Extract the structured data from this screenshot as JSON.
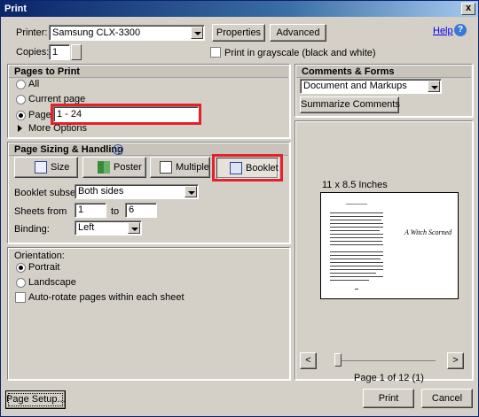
{
  "window": {
    "title": "Print",
    "close": "x"
  },
  "printer": {
    "label": "Printer:",
    "value": "Samsung CLX-3300",
    "properties": "Properties",
    "advanced": "Advanced",
    "help": "Help",
    "copies_label": "Copies:",
    "copies_value": "1",
    "grayscale_label": "Print in grayscale (black and white)"
  },
  "pages": {
    "heading": "Pages to Print",
    "all": "All",
    "current": "Current page",
    "pages": "Pages",
    "range": "1 - 24",
    "more": "More Options"
  },
  "sizing": {
    "heading": "Page Sizing & Handling",
    "info_icon": "i",
    "buttons": {
      "size": "Size",
      "poster": "Poster",
      "multiple": "Multiple",
      "booklet": "Booklet"
    },
    "subset_label": "Booklet subset:",
    "subset_value": "Both sides",
    "sheets_label": "Sheets from",
    "sheets_from": "1",
    "to_label": "to",
    "sheets_to": "6",
    "binding_label": "Binding:",
    "binding_value": "Left"
  },
  "orientation": {
    "label": "Orientation:",
    "portrait": "Portrait",
    "landscape": "Landscape",
    "autorotate": "Auto-rotate pages within each sheet"
  },
  "comments": {
    "heading": "Comments & Forms",
    "value": "Document and Markups",
    "summarize": "Summarize Comments"
  },
  "preview": {
    "size_label": "11 x 8.5 Inches",
    "right_title": "A Witch Scorned",
    "page_info": "Page 1 of 12 (1)",
    "prev": "<",
    "next": ">"
  },
  "footer": {
    "setup": "Page Setup...",
    "print": "Print",
    "cancel": "Cancel"
  },
  "colors": {
    "highlight": "#e4202a",
    "title_bar": "#0a246a",
    "link": "#0000ee"
  }
}
